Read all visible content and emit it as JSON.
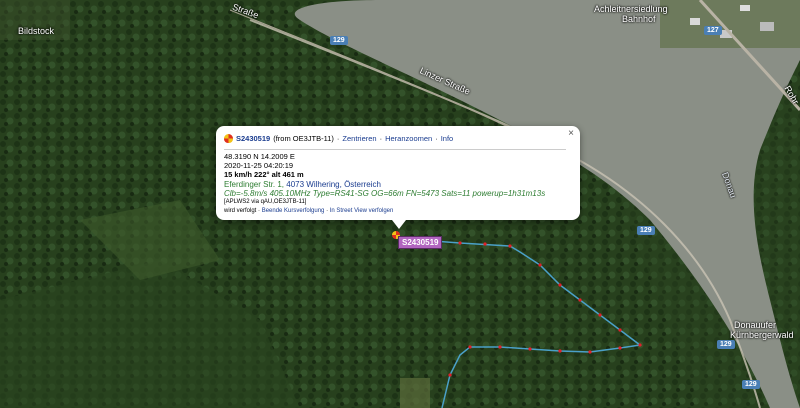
{
  "colors": {
    "forest": "#27401d",
    "river": "#8a8f86",
    "track": "#4aa0c8",
    "track_point": "#e0202a",
    "label_bg": "#b265c0",
    "shield": "#4a7fb5"
  },
  "map": {
    "places": {
      "bildstock": "Bildstock",
      "bahnhof_line1": "Achleitnersiedlung",
      "bahnhof_line2": "Bahnhof",
      "donauufer_line1": "Donauufer",
      "donauufer_line2": "Kürnbergerwald",
      "river": "Donau"
    },
    "roads": {
      "strasse_top": "Straße",
      "linzer": "Linzer Straße",
      "rohr": "Rohr"
    },
    "route_shields": [
      "129",
      "127",
      "129",
      "129",
      "129"
    ]
  },
  "popup": {
    "callsign": "S2430519",
    "from_text": "(from OE3JTB-11)",
    "links": [
      "Zentrieren",
      "Heranzoomen",
      "Info"
    ],
    "coords": "48.3190 N 14.2009 E",
    "time": "2020-11-25 04:20:19",
    "speed_alt": "15 km/h 222° alt 461 m",
    "address_street": "Eferdinger Str. 1,",
    "address_city": "4073 Wilhering, Österreich",
    "comment": "Clb=-5.8m/s 405.10MHz Type=RS41-SG OG=66m FN=5473 Sats=11 powerup=1h31m13s",
    "path": "[APLWS2 via qAU,OE3JTB-11]",
    "following_prefix": "wird verfolgt ·",
    "following_links": [
      "Beende Kursverfolgung",
      "In Street View verfolgen"
    ],
    "close": "×"
  },
  "marker": {
    "label": "S2430519"
  }
}
